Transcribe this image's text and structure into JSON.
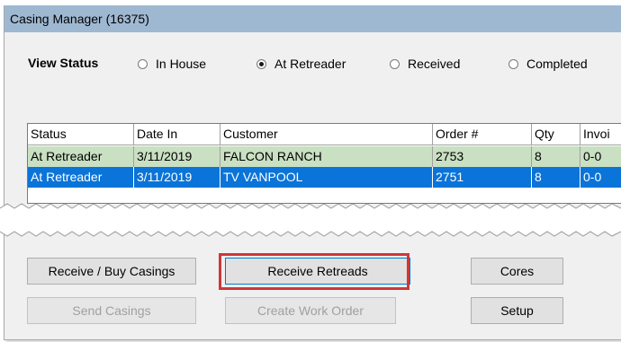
{
  "window": {
    "title": "Casing Manager (16375)"
  },
  "view_status": {
    "label": "View Status",
    "options": [
      {
        "label": "In House",
        "selected": false
      },
      {
        "label": "At Retreader",
        "selected": true
      },
      {
        "label": "Received",
        "selected": false
      },
      {
        "label": "Completed",
        "selected": false
      }
    ]
  },
  "table": {
    "columns": [
      "Status",
      "Date In",
      "Customer",
      "Order #",
      "Qty",
      "Invoi"
    ],
    "rows": [
      {
        "status": "At Retreader",
        "date_in": "3/11/2019",
        "customer": "FALCON RANCH",
        "order": "2753",
        "qty": "8",
        "invoice": "0-0",
        "state": "normal"
      },
      {
        "status": "At Retreader",
        "date_in": "3/11/2019",
        "customer": "TV VANPOOL",
        "order": "2751",
        "qty": "8",
        "invoice": "0-0",
        "state": "selected"
      }
    ]
  },
  "buttons": {
    "receive_buy_casings": "Receive / Buy Casings",
    "receive_retreads": "Receive Retreads",
    "cores": "Cores",
    "send_casings": "Send Casings",
    "create_work_order": "Create Work Order",
    "setup": "Setup"
  },
  "colors": {
    "titlebar": "#9fb8d2",
    "row_highlight_green": "#c9e0c2",
    "row_selected_blue": "#0a74d8",
    "callout_red": "#d0363a"
  }
}
